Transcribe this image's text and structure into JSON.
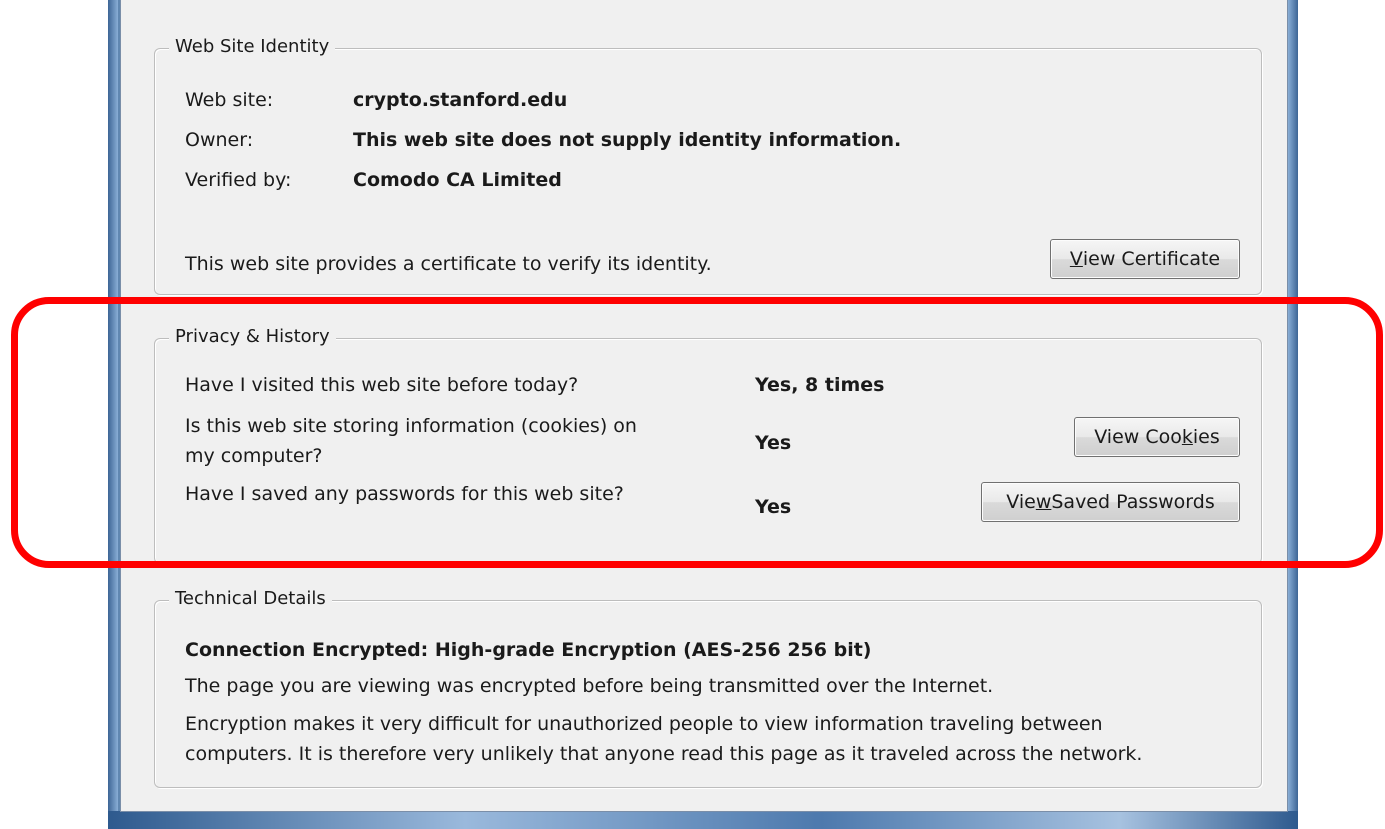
{
  "identity": {
    "title": "Web Site Identity",
    "labels": {
      "website": "Web site:",
      "owner": "Owner:",
      "verified_by": "Verified by:"
    },
    "values": {
      "website": "crypto.stanford.edu",
      "owner": "This web site does not supply identity information.",
      "verified_by": "Comodo CA Limited"
    },
    "note": "This web site provides a certificate to verify its identity.",
    "view_certificate_button": {
      "accel": "V",
      "rest": "iew Certificate"
    }
  },
  "privacy": {
    "title": "Privacy & History",
    "q_visited": "Have I visited this web site before today?",
    "a_visited": "Yes, 8 times",
    "q_cookies_line1": "Is this web site storing information (cookies) on",
    "q_cookies_line2": "my computer?",
    "a_cookies": "Yes",
    "view_cookies_button": {
      "pre": "View Coo",
      "accel": "k",
      "post": "ies"
    },
    "q_passwords": "Have I saved any passwords for this web site?",
    "a_passwords": "Yes",
    "view_passwords_button": {
      "pre": "Vie",
      "accel": "w",
      "post": " Saved Passwords"
    }
  },
  "technical": {
    "title": "Technical Details",
    "heading": "Connection Encrypted: High-grade Encryption (AES-256 256 bit)",
    "line1": "The page you are viewing was encrypted before being transmitted over the Internet.",
    "line2": "Encryption makes it very difficult for unauthorized people to view information traveling between",
    "line3": "computers. It is therefore very unlikely that anyone read this page as it traveled across the network."
  },
  "colors": {
    "highlight": "#ff0000",
    "dialog_bg": "#f0f0f0",
    "frame": "#5f86b0"
  }
}
